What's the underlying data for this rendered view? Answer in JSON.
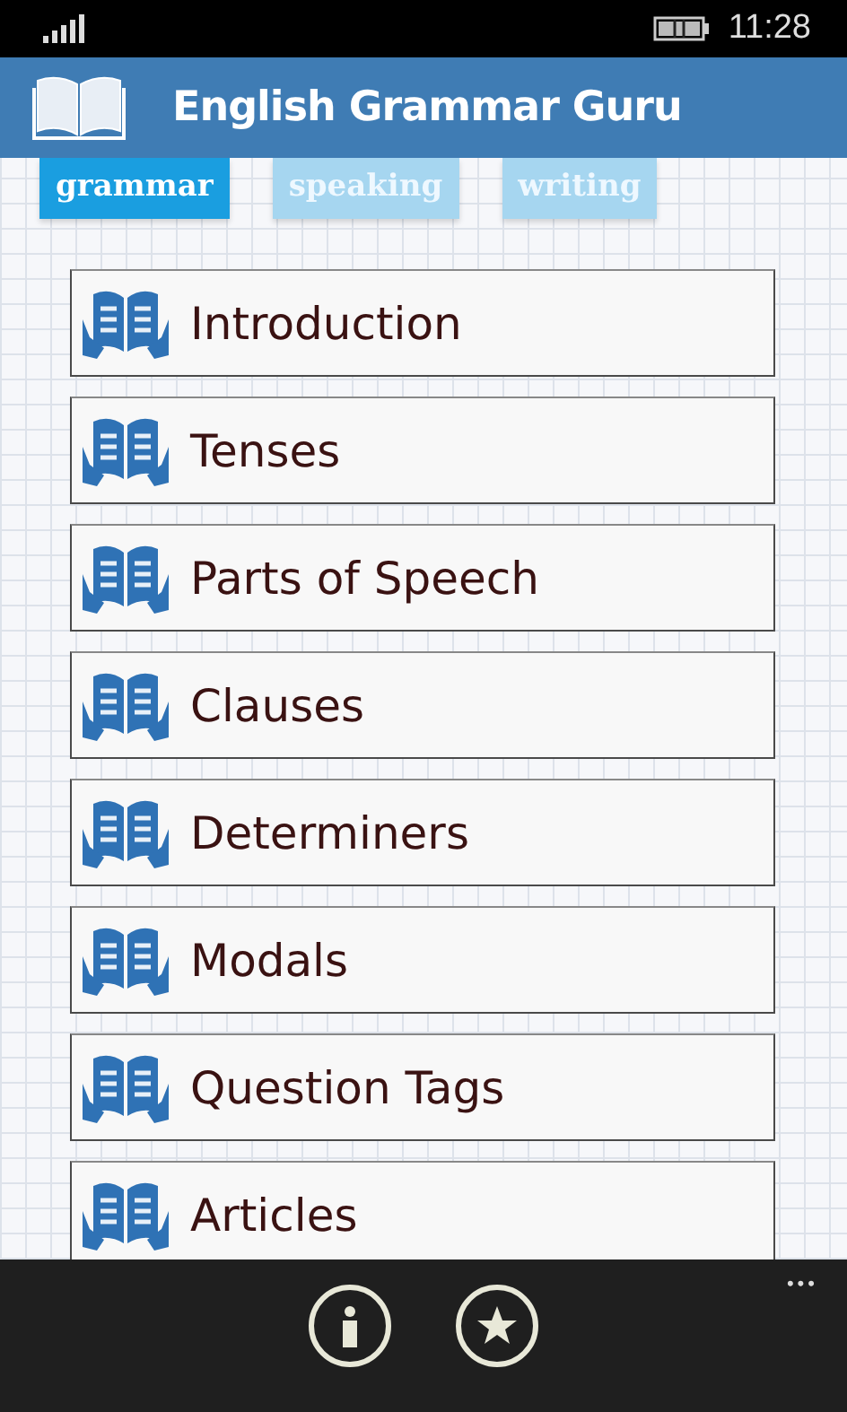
{
  "status_bar": {
    "time": "11:28"
  },
  "header": {
    "title": "English Grammar Guru"
  },
  "tabs": [
    {
      "label": "grammar",
      "selected": true
    },
    {
      "label": "speaking",
      "selected": false
    },
    {
      "label": "writing",
      "selected": false
    }
  ],
  "topics": [
    {
      "label": "Introduction"
    },
    {
      "label": "Tenses"
    },
    {
      "label": "Parts of Speech"
    },
    {
      "label": "Clauses"
    },
    {
      "label": "Determiners"
    },
    {
      "label": "Modals"
    },
    {
      "label": "Question Tags"
    },
    {
      "label": "Articles"
    }
  ],
  "app_bar": {
    "more": "•••"
  }
}
